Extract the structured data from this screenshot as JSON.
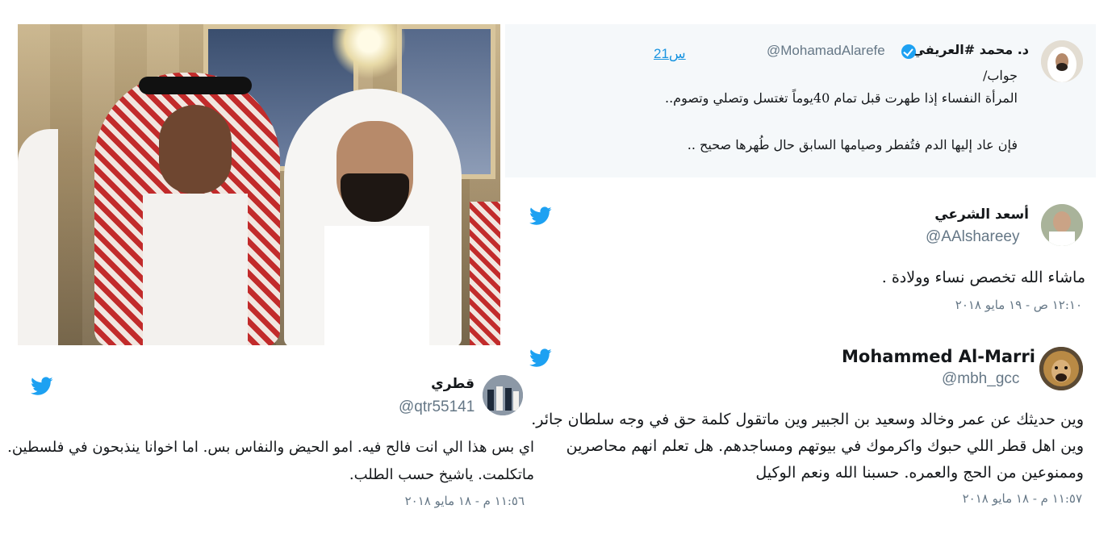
{
  "tweet_main": {
    "name": "د. محمد #العريفي",
    "handle": "@MohamadAlarefe",
    "time": "21س",
    "lines": [
      "جواب/",
      "المرأة النفساء إذا طهرت قبل تمام 40يوماً تغتسل وتصلي وتصوم..",
      "فإن عاد إليها الدم فتُفطر وصيامها السابق حال طُهرها صحيح .."
    ],
    "verified_icon": "verified-badge-icon"
  },
  "tweet_asad": {
    "name": "أسعد الشرعي",
    "handle": "@AAlshareey",
    "text": "ماشاء الله تخصص نساء وولادة .",
    "meta": "١٢:١٠ ص - ١٩ مايو ٢٠١٨",
    "icon": "twitter-bird-icon"
  },
  "tweet_marri": {
    "name": "Mohammed Al-Marri",
    "handle": "@mbh_gcc",
    "lines": [
      "وين حديثك عن عمر وخالد وسعيد بن الجبير وين ماتقول كلمة حق في وجه سلطان جائر.",
      "وين اهل قطر اللي حبوك واكرموك في بيوتهم ومساجدهم. هل تعلم انهم محاصرين",
      "وممنوعين من الحج والعمره. حسبنا الله ونعم الوكيل"
    ],
    "meta": "١١:٥٧ م - ١٨ مايو ٢٠١٨",
    "icon": "twitter-bird-icon"
  },
  "tweet_qatari": {
    "name": "قطري",
    "handle": "@qtr55141",
    "lines": [
      "اي بس هذا الي انت فالح فيه. امو الحيض والنفاس بس. اما اخوانا ينذبحون في فلسطين.",
      "ماتكلمت. ياشيخ حسب الطلب."
    ],
    "meta": "١١:٥٦ م - ١٨ مايو ٢٠١٨",
    "icon": "twitter-bird-icon"
  },
  "colors": {
    "twitter_blue": "#1da1f2",
    "text": "#14171a",
    "muted": "#657786",
    "card_bg": "#f5f8fa"
  }
}
